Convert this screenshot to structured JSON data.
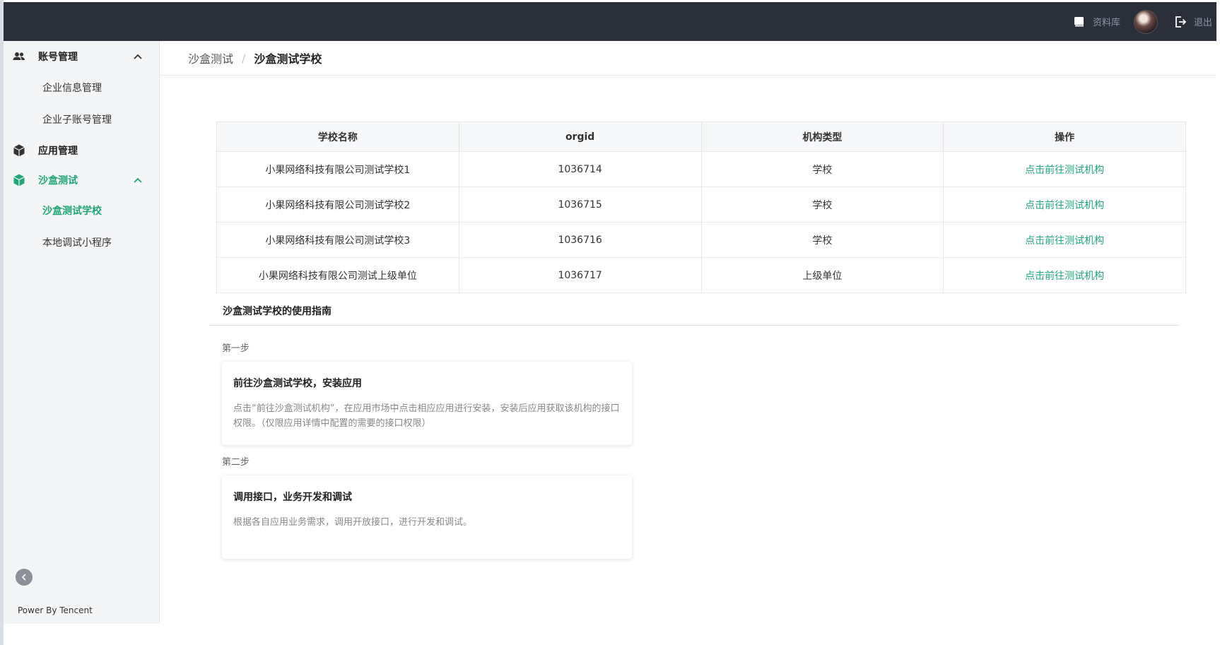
{
  "header": {
    "docs_label": "资料库",
    "logout_label": "退出"
  },
  "sidebar": {
    "groups": [
      {
        "label": "账号管理",
        "icon": "users-icon",
        "expanded": true,
        "items": [
          {
            "label": "企业信息管理"
          },
          {
            "label": "企业子账号管理"
          }
        ]
      },
      {
        "label": "应用管理",
        "icon": "cube-icon",
        "expanded": false,
        "items": []
      },
      {
        "label": "沙盒测试",
        "icon": "cube-icon",
        "expanded": true,
        "active": true,
        "items": [
          {
            "label": "沙盒测试学校",
            "active": true
          },
          {
            "label": "本地调试小程序"
          }
        ]
      }
    ],
    "footer": "Power By Tencent"
  },
  "breadcrumb": {
    "items": [
      "沙盒测试",
      "沙盒测试学校"
    ],
    "separator": "/"
  },
  "table": {
    "headers": [
      "学校名称",
      "orgid",
      "机构类型",
      "操作"
    ],
    "rows": [
      {
        "name": "小果网络科技有限公司测试学校1",
        "orgid": "1036714",
        "type": "学校",
        "action": "点击前往测试机构"
      },
      {
        "name": "小果网络科技有限公司测试学校2",
        "orgid": "1036715",
        "type": "学校",
        "action": "点击前往测试机构"
      },
      {
        "name": "小果网络科技有限公司测试学校3",
        "orgid": "1036716",
        "type": "学校",
        "action": "点击前往测试机构"
      },
      {
        "name": "小果网络科技有限公司测试上级单位",
        "orgid": "1036717",
        "type": "上级单位",
        "action": "点击前往测试机构"
      }
    ]
  },
  "guide": {
    "title": "沙盒测试学校的使用指南",
    "steps": [
      {
        "label": "第一步",
        "title": "前往沙盒测试学校，安装应用",
        "desc": "点击“前往沙盒测试机构”，在应用市场中点击相应应用进行安装，安装后应用获取该机构的接口权限。（仅限应用详情中配置的需要的接口权限）"
      },
      {
        "label": "第二步",
        "title": "调用接口，业务开发和调试",
        "desc": "根据各自应用业务需求，调用开放接口，进行开发和调试。"
      }
    ]
  },
  "colors": {
    "accent": "#21a67a",
    "topbar": "#2b2f3a",
    "sidebar_bg": "#f4f5f7"
  }
}
